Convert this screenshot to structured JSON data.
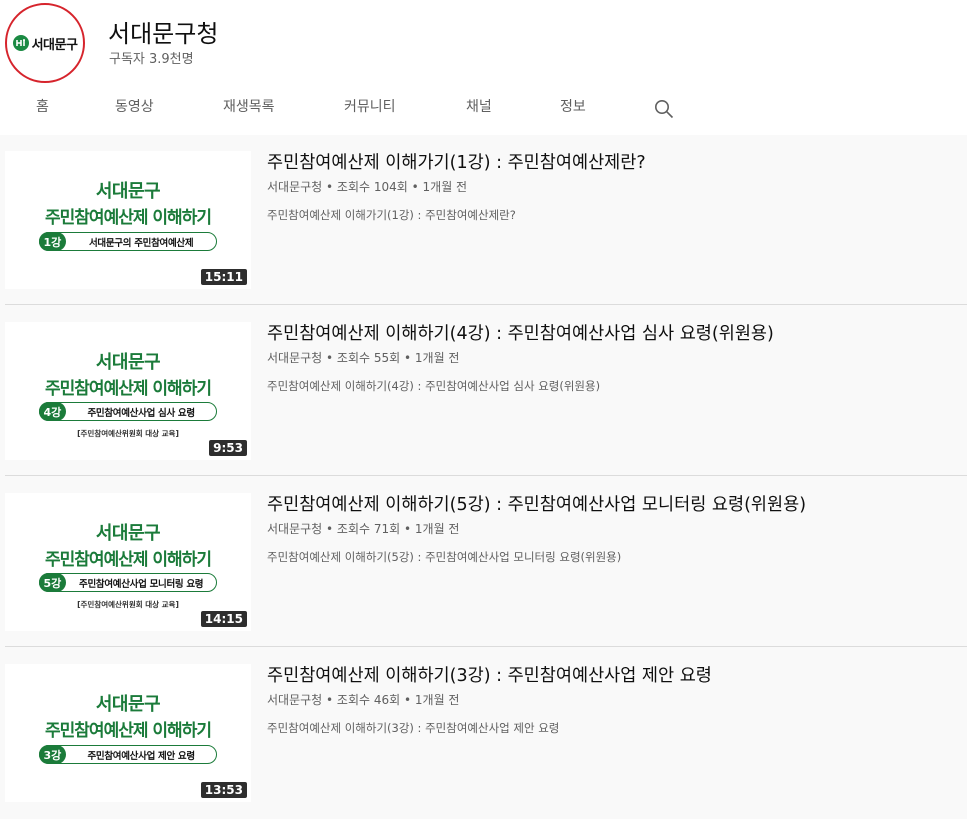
{
  "channel": {
    "logo_text": "서대문구",
    "name": "서대문구청",
    "subscribers": "구독자 3.9천명"
  },
  "tabs": [
    {
      "label": "홈"
    },
    {
      "label": "동영상"
    },
    {
      "label": "재생목록"
    },
    {
      "label": "커뮤니티"
    },
    {
      "label": "채널"
    },
    {
      "label": "정보"
    }
  ],
  "search_icon": "search-icon",
  "colors": {
    "brand_green": "#1b7b3a",
    "logo_ring": "#d6242c"
  },
  "videos": [
    {
      "thumb_line1": "서대문구",
      "thumb_line2": "주민참여예산제 이해하기",
      "thumb_num": "1강",
      "thumb_pill_text": "서대문구의 주민참여예산제",
      "thumb_sub": "",
      "duration": "15:11",
      "title": "주민참여예산제 이해가기(1강) : 주민참여예산제란?",
      "channel": "서대문구청",
      "views": "조회수 104회",
      "age": "1개월 전",
      "description": "주민참여예산제 이해가기(1강) : 주민참여예산제란?"
    },
    {
      "thumb_line1": "서대문구",
      "thumb_line2": "주민참여예산제 이해하기",
      "thumb_num": "4강",
      "thumb_pill_text": "주민참여예산사업 심사 요령",
      "thumb_sub": "[주민참여예산위원회 대상 교육]",
      "duration": "9:53",
      "title": "주민참여예산제 이해하기(4강) : 주민참여예산사업 심사 요령(위원용)",
      "channel": "서대문구청",
      "views": "조회수 55회",
      "age": "1개월 전",
      "description": "주민참여예산제 이해하기(4강) : 주민참여예산사업 심사 요령(위원용)"
    },
    {
      "thumb_line1": "서대문구",
      "thumb_line2": "주민참여예산제 이해하기",
      "thumb_num": "5강",
      "thumb_pill_text": "주민참여예산사업 모니터링 요령",
      "thumb_sub": "[주민참여예산위원회 대상 교육]",
      "duration": "14:15",
      "title": "주민참여예산제 이해하기(5강) : 주민참여예산사업 모니터링 요령(위원용)",
      "channel": "서대문구청",
      "views": "조회수 71회",
      "age": "1개월 전",
      "description": "주민참여예산제 이해하기(5강) : 주민참여예산사업 모니터링 요령(위원용)"
    },
    {
      "thumb_line1": "서대문구",
      "thumb_line2": "주민참여예산제 이해하기",
      "thumb_num": "3강",
      "thumb_pill_text": "주민참여예산사업 제안 요령",
      "thumb_sub": "",
      "duration": "13:53",
      "title": "주민참여예산제 이해하기(3강) : 주민참여예산사업 제안 요령",
      "channel": "서대문구청",
      "views": "조회수 46회",
      "age": "1개월 전",
      "description": "주민참여예산제 이해하기(3강) : 주민참여예산사업 제안 요령"
    }
  ]
}
